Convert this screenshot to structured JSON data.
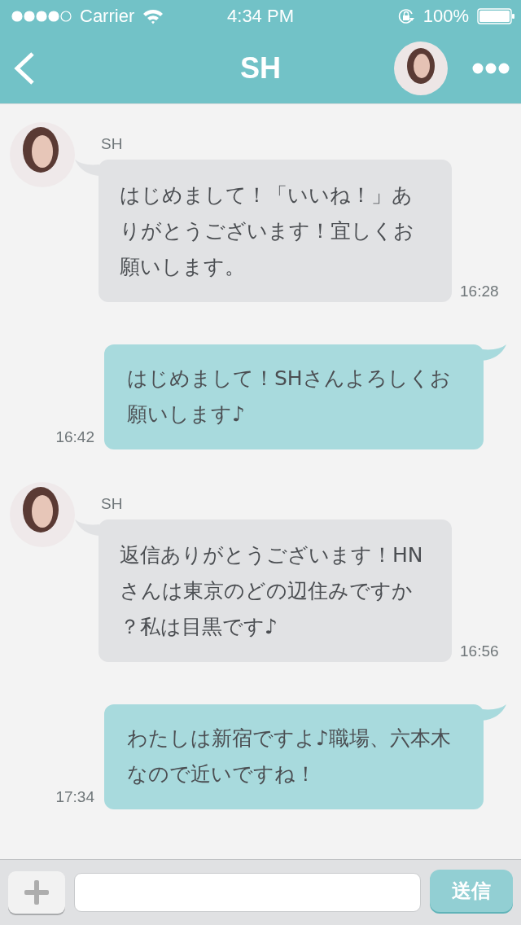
{
  "status_bar": {
    "carrier": "Carrier",
    "time": "4:34 PM",
    "battery": "100%"
  },
  "nav": {
    "title": "SH"
  },
  "messages": [
    {
      "kind": "incoming",
      "sender": "SH",
      "text": "はじめまして！「いいね！」ありがとうございます！宜しくお願いします。",
      "time": "16:28"
    },
    {
      "kind": "outgoing",
      "text": "はじめまして！SHさんよろしくお願いします♪",
      "time": "16:42"
    },
    {
      "kind": "incoming",
      "sender": "SH",
      "text": "返信ありがとうございます！HNさんは東京のどの辺住みですか？私は目黒です♪",
      "time": "16:56"
    },
    {
      "kind": "outgoing",
      "text": "わたしは新宿ですよ♪職場、六本木なので近いですね！",
      "time": "17:34"
    }
  ],
  "composer": {
    "send": "送信"
  }
}
